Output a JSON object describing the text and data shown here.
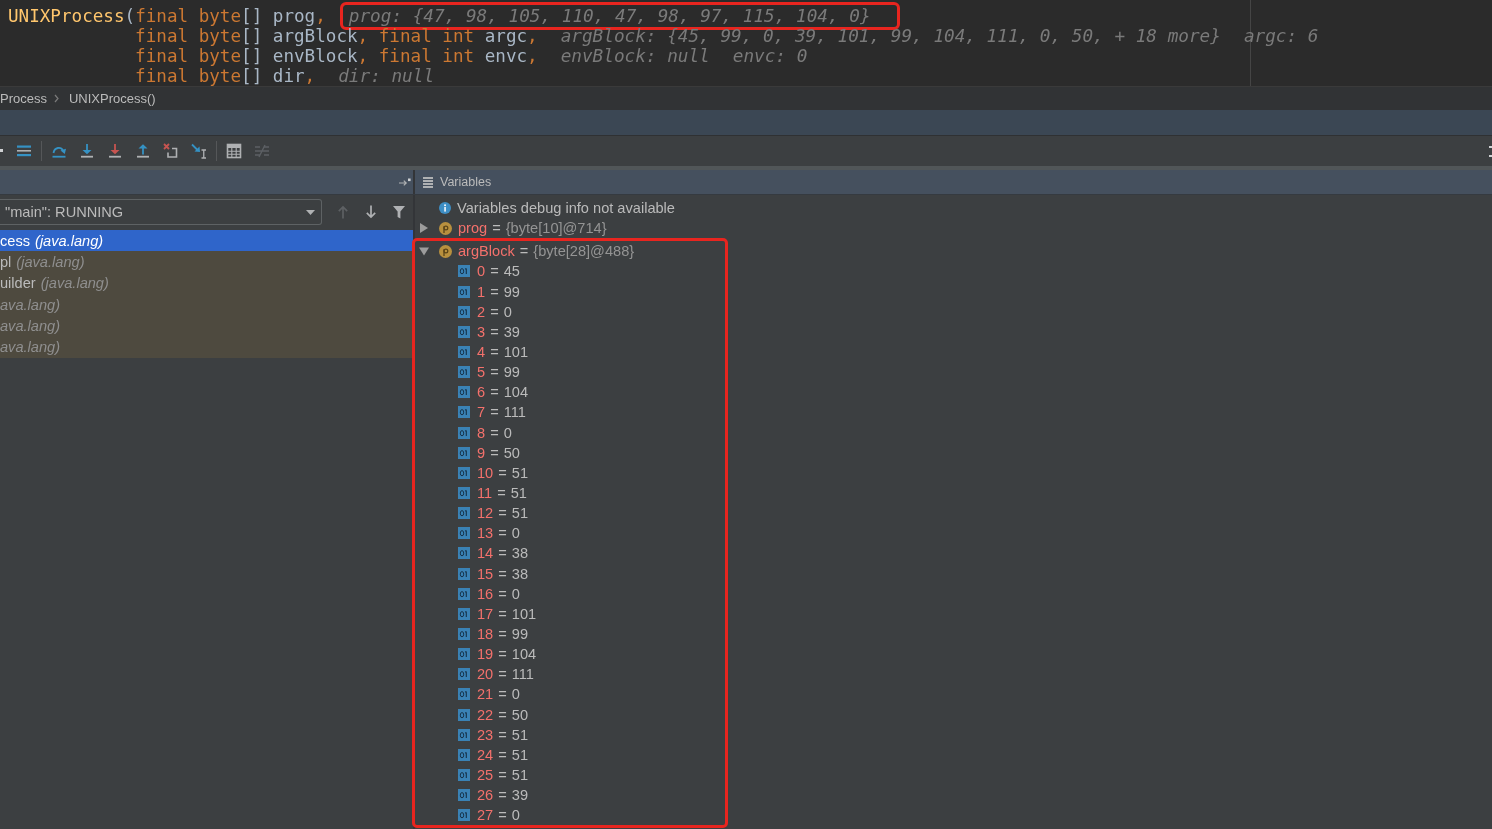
{
  "editor": {
    "lines": [
      {
        "tokens": [
          {
            "kind": "function",
            "text": "UNIXProcess"
          },
          {
            "kind": "plain",
            "text": "("
          },
          {
            "kind": "keyword",
            "text": "final byte"
          },
          {
            "kind": "plain",
            "text": "[] prog"
          },
          {
            "kind": "punct",
            "text": ","
          }
        ],
        "hints": [
          {
            "text": "prog: {47, 98, 105, 110, 47, 98, 97, 115, 104, 0}",
            "highlighted": true
          }
        ]
      },
      {
        "tokens": [
          {
            "kind": "keyword",
            "text": "            final byte"
          },
          {
            "kind": "plain",
            "text": "[] argBlock"
          },
          {
            "kind": "punct",
            "text": ", "
          },
          {
            "kind": "keyword",
            "text": "final int "
          },
          {
            "kind": "plain",
            "text": "argc"
          },
          {
            "kind": "punct",
            "text": ","
          }
        ],
        "hints": [
          {
            "text": "argBlock: {45, 99, 0, 39, 101, 99, 104, 111, 0, 50, + 18 more}",
            "highlighted": false
          },
          {
            "text": "argc: 6",
            "highlighted": false
          }
        ]
      },
      {
        "tokens": [
          {
            "kind": "keyword",
            "text": "            final byte"
          },
          {
            "kind": "plain",
            "text": "[] envBlock"
          },
          {
            "kind": "punct",
            "text": ", "
          },
          {
            "kind": "keyword",
            "text": "final int "
          },
          {
            "kind": "plain",
            "text": "envc"
          },
          {
            "kind": "punct",
            "text": ","
          }
        ],
        "hints": [
          {
            "text": "envBlock: null",
            "highlighted": false
          },
          {
            "text": "envc: 0",
            "highlighted": false
          }
        ]
      },
      {
        "tokens": [
          {
            "kind": "keyword",
            "text": "            final byte"
          },
          {
            "kind": "plain",
            "text": "[] dir"
          },
          {
            "kind": "punct",
            "text": ","
          }
        ],
        "hints": [
          {
            "text": "dir: null",
            "highlighted": false
          }
        ]
      }
    ]
  },
  "breadcrumb": [
    "Process",
    "UNIXProcess()"
  ],
  "debug_toolbar": [
    {
      "kind": "edge"
    },
    {
      "kind": "show-execution-point",
      "disabled": false
    },
    {
      "kind": "separator"
    },
    {
      "kind": "step-over",
      "disabled": false
    },
    {
      "kind": "step-into",
      "disabled": false
    },
    {
      "kind": "force-step-into",
      "disabled": false
    },
    {
      "kind": "step-out",
      "disabled": false
    },
    {
      "kind": "drop-frame",
      "disabled": false
    },
    {
      "kind": "run-to-cursor",
      "disabled": false
    },
    {
      "kind": "separator"
    },
    {
      "kind": "evaluate",
      "disabled": false
    },
    {
      "kind": "trace",
      "disabled": true
    },
    {
      "kind": "overflow"
    }
  ],
  "frames_panel": {
    "thread": "\"main\": RUNNING",
    "nav_buttons": [
      {
        "kind": "up",
        "disabled": true
      },
      {
        "kind": "down",
        "disabled": false
      },
      {
        "kind": "filter",
        "disabled": false
      }
    ],
    "frames": [
      {
        "method": "cess",
        "package": "(java.lang)",
        "selected": true
      },
      {
        "method": "pl",
        "package": "(java.lang)",
        "selected": false
      },
      {
        "method": "uilder",
        "package": "(java.lang)",
        "selected": false
      },
      {
        "package": "ava.lang)",
        "selected": false
      },
      {
        "package": "ava.lang)",
        "selected": false
      },
      {
        "package": "ava.lang)",
        "selected": false
      }
    ]
  },
  "variables_panel": {
    "title": "Variables",
    "notice": "Variables debug info not available",
    "variables": [
      {
        "name": "prog",
        "operator": "=",
        "value": "{byte[10]@714}",
        "expanded": false,
        "highlighted": false
      },
      {
        "name": "argBlock",
        "operator": "=",
        "value": "{byte[28]@488}",
        "expanded": true,
        "highlighted": true,
        "children": [
          {
            "name": "0",
            "operator": "=",
            "value": "45"
          },
          {
            "name": "1",
            "operator": "=",
            "value": "99"
          },
          {
            "name": "2",
            "operator": "=",
            "value": "0"
          },
          {
            "name": "3",
            "operator": "=",
            "value": "39"
          },
          {
            "name": "4",
            "operator": "=",
            "value": "101"
          },
          {
            "name": "5",
            "operator": "=",
            "value": "99"
          },
          {
            "name": "6",
            "operator": "=",
            "value": "104"
          },
          {
            "name": "7",
            "operator": "=",
            "value": "111"
          },
          {
            "name": "8",
            "operator": "=",
            "value": "0"
          },
          {
            "name": "9",
            "operator": "=",
            "value": "50"
          },
          {
            "name": "10",
            "operator": "=",
            "value": "51"
          },
          {
            "name": "11",
            "operator": "=",
            "value": "51"
          },
          {
            "name": "12",
            "operator": "=",
            "value": "51"
          },
          {
            "name": "13",
            "operator": "=",
            "value": "0"
          },
          {
            "name": "14",
            "operator": "=",
            "value": "38"
          },
          {
            "name": "15",
            "operator": "=",
            "value": "38"
          },
          {
            "name": "16",
            "operator": "=",
            "value": "0"
          },
          {
            "name": "17",
            "operator": "=",
            "value": "101"
          },
          {
            "name": "18",
            "operator": "=",
            "value": "99"
          },
          {
            "name": "19",
            "operator": "=",
            "value": "104"
          },
          {
            "name": "20",
            "operator": "=",
            "value": "111"
          },
          {
            "name": "21",
            "operator": "=",
            "value": "0"
          },
          {
            "name": "22",
            "operator": "=",
            "value": "50"
          },
          {
            "name": "23",
            "operator": "=",
            "value": "51"
          },
          {
            "name": "24",
            "operator": "=",
            "value": "51"
          },
          {
            "name": "25",
            "operator": "=",
            "value": "51"
          },
          {
            "name": "26",
            "operator": "=",
            "value": "39"
          },
          {
            "name": "27",
            "operator": "=",
            "value": "0"
          }
        ]
      }
    ]
  }
}
